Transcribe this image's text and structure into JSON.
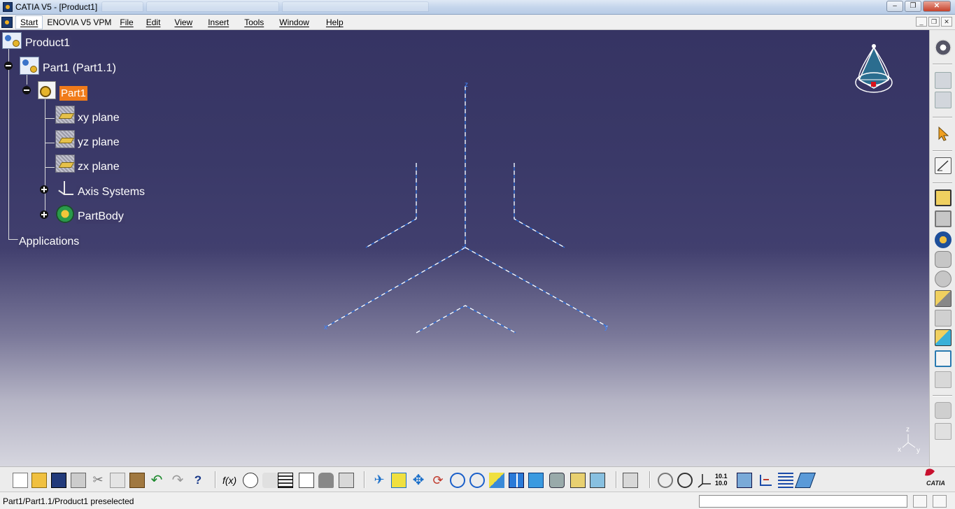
{
  "window": {
    "title": "CATIA V5 - [Product1]",
    "controls": [
      "minimize",
      "maximize",
      "close"
    ]
  },
  "menubar": {
    "items": [
      {
        "label": "Start"
      },
      {
        "label": "ENOVIA V5 VPM"
      },
      {
        "label": "File"
      },
      {
        "label": "Edit"
      },
      {
        "label": "View"
      },
      {
        "label": "Insert"
      },
      {
        "label": "Tools"
      },
      {
        "label": "Window"
      },
      {
        "label": "Help"
      }
    ]
  },
  "tree": {
    "root": "Product1",
    "part_instance": "Part1 (Part1.1)",
    "part": "Part1",
    "planes": [
      "xy plane",
      "yz plane",
      "zx plane"
    ],
    "axis_systems": "Axis Systems",
    "part_body": "PartBody",
    "applications": "Applications"
  },
  "viewport": {
    "axis_labels": {
      "z": "z",
      "x": "x",
      "y": "y"
    },
    "mini_axis": {
      "z": "z",
      "x": "x",
      "y": "y"
    },
    "background_top": "#363463",
    "background_bottom": "#d6d6df",
    "axis_color": "#2f6fd8"
  },
  "right_toolbar": {
    "icons": [
      "sketcher-settings-icon",
      "product-icon",
      "catalog-icon",
      "select-icon",
      "sketch-icon",
      "pad-icon",
      "pocket-icon",
      "shaft-icon",
      "groove-icon",
      "hole-icon",
      "rib-icon",
      "slot-icon",
      "stiffener-icon",
      "loft-icon",
      "remove-loft-icon",
      "solid-icon",
      "surface-icon"
    ]
  },
  "bottom_toolbar": {
    "formula_label": "f(x)",
    "dimension_label_top": "10.1",
    "dimension_label_bottom": "10.0",
    "icons": [
      "new-icon",
      "open-icon",
      "save-icon",
      "print-icon",
      "cut-icon",
      "copy-icon",
      "paste-icon",
      "undo-icon",
      "redo-icon",
      "whats-this-icon",
      "formula-icon",
      "comment-icon",
      "knowledge-icon",
      "table-icon",
      "tree-icon",
      "lock-icon",
      "parameter-icon",
      "fly-mode-icon",
      "fit-all-icon",
      "pan-icon",
      "rotate-icon",
      "zoom-in-icon",
      "zoom-out-icon",
      "normal-view-icon",
      "multi-view-icon",
      "iso-view-icon",
      "render-style-icon",
      "hide-show-icon",
      "swap-icon",
      "export-icon",
      "update-icon",
      "manipulate-icon",
      "axis-system-icon",
      "measure-icon",
      "apply-material-icon",
      "axis-icon",
      "list-icon",
      "eraser-icon"
    ]
  },
  "status": {
    "text": "Part1/Part1.1/Product1 preselected",
    "command_input": ""
  },
  "logo": {
    "text": "CATIA"
  }
}
